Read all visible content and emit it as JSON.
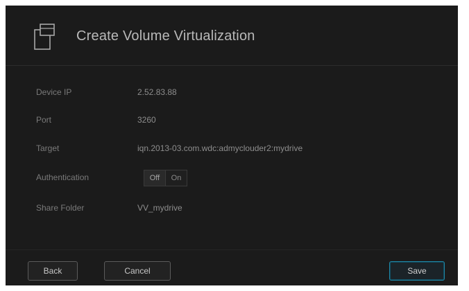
{
  "dialog": {
    "title": "Create Volume Virtualization",
    "icon": "volume-stack-icon"
  },
  "form": {
    "device_ip": {
      "label": "Device IP",
      "value": "2.52.83.88"
    },
    "port": {
      "label": "Port",
      "value": "3260"
    },
    "target": {
      "label": "Target",
      "value": "iqn.2013-03.com.wdc:admyclouder2:mydrive"
    },
    "authentication": {
      "label": "Authentication",
      "options": [
        "Off",
        "On"
      ],
      "selected": "Off"
    },
    "share_folder": {
      "label": "Share Folder",
      "value": "VV_mydrive"
    }
  },
  "footer": {
    "back_label": "Back",
    "cancel_label": "Cancel",
    "save_label": "Save"
  },
  "colors": {
    "dialog_bg": "#1b1b1b",
    "save_accent": "#1f87a6"
  }
}
